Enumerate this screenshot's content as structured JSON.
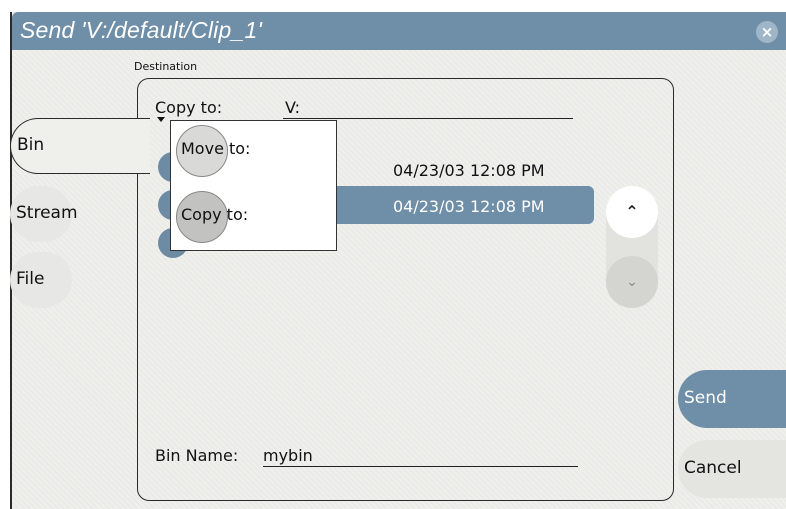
{
  "window": {
    "title": "Send 'V:/default/Clip_1'",
    "close_symbol": "×"
  },
  "colors": {
    "title_bar": "#6f8ea7",
    "selected_row": "#6f8ea7",
    "send_button": "#6f8ea7",
    "panel_bg": "#efefec"
  },
  "destination": {
    "section_label": "Destination",
    "mode_label": "Copy to:",
    "mode_dropdown_icon": "triangle-down-icon",
    "volume": "V:"
  },
  "side_tabs": [
    {
      "label": "Bin",
      "active": true
    },
    {
      "label": "Stream",
      "active": false
    },
    {
      "label": "File",
      "active": false
    }
  ],
  "list": {
    "rows": [
      {
        "date": "04/23/03 12:08 PM",
        "selected": false
      },
      {
        "date": "04/23/03 12:08 PM",
        "selected": true
      },
      {
        "date": "",
        "selected": false
      }
    ],
    "scroll_up_icon": "chevron-up-icon",
    "scroll_down_icon": "chevron-down-icon"
  },
  "menu": {
    "items": [
      {
        "label": "Move to:"
      },
      {
        "label": "Copy to:"
      }
    ]
  },
  "bin_name": {
    "label": "Bin Name:",
    "value": "mybin"
  },
  "actions": {
    "send_label": "Send",
    "cancel_label": "Cancel"
  }
}
